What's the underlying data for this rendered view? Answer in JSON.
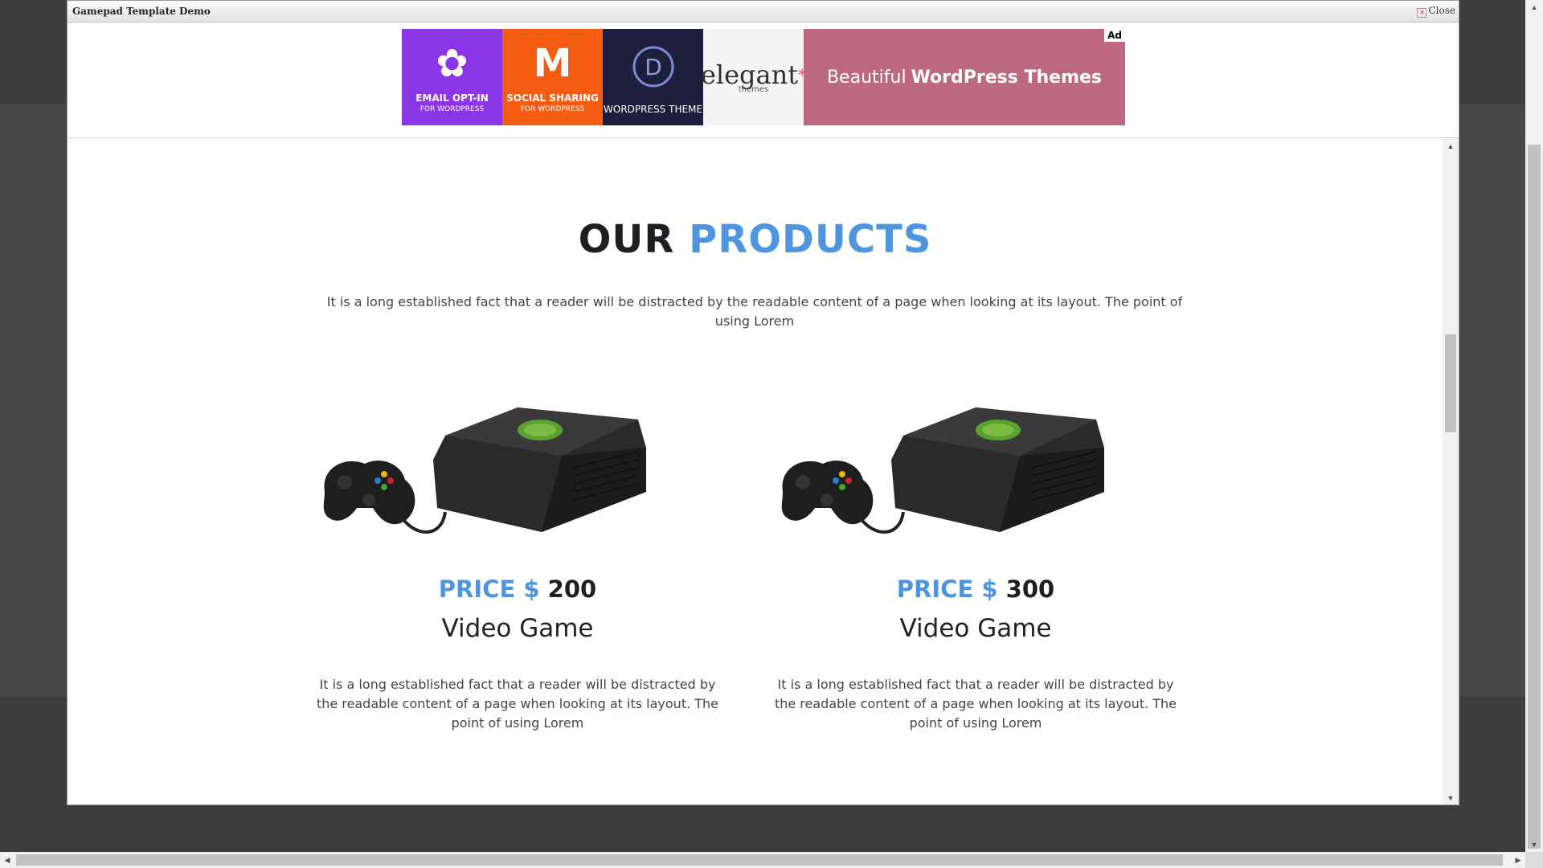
{
  "dialog": {
    "title": "Gamepad Template Demo",
    "close_label": "Close"
  },
  "ad": {
    "label": "Ad",
    "tiles": [
      {
        "line1": "EMAIL OPT-IN",
        "line2": "FOR WORDPRESS",
        "color": "#8a35e6"
      },
      {
        "line1": "SOCIAL SHARING",
        "line2": "FOR WORDPRESS",
        "color": "#f65d12"
      },
      {
        "line1": "WORDPRESS THEME",
        "line2": "",
        "color": "#1d1f3d"
      }
    ],
    "brand": "elegant",
    "brand_sub": "themes",
    "tagline_plain": "Beautiful",
    "tagline_bold": "WordPress Themes",
    "tagline_color": "#bd6881"
  },
  "section": {
    "heading_dark": "OUR",
    "heading_accent": "PRODUCTS",
    "accent_color": "#4f95de",
    "intro": "It is a long established fact that a reader will be distracted by the readable content of a page when looking at its layout. The point of using Lorem"
  },
  "products": [
    {
      "price_label": "PRICE $",
      "price_value": "200",
      "name": "Video Game",
      "description": "It is a long established fact that a reader will be distracted by the readable content of a page when looking at its layout. The point of using Lorem"
    },
    {
      "price_label": "PRICE $",
      "price_value": "300",
      "name": "Video Game",
      "description": "It is a long established fact that a reader will be distracted by the readable content of a page when looking at its layout. The point of using Lorem"
    }
  ]
}
